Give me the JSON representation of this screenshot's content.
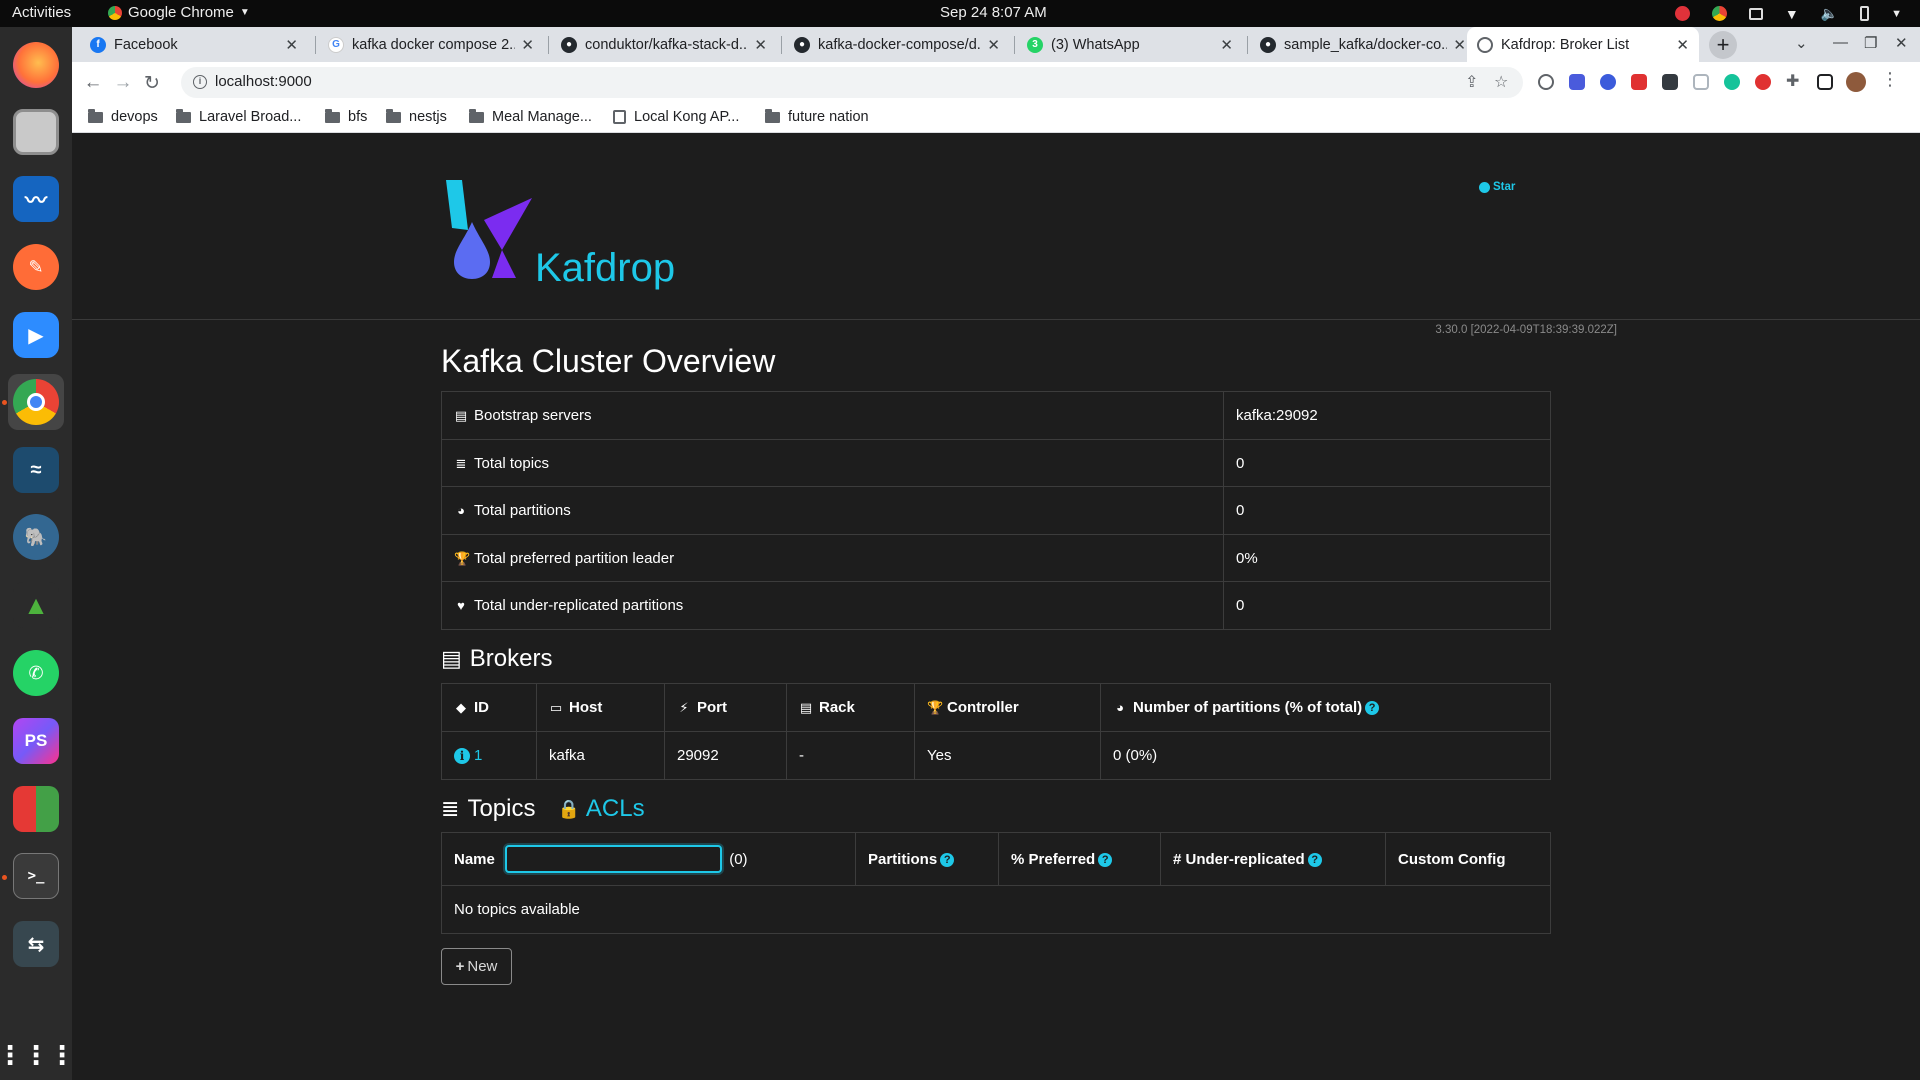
{
  "system": {
    "activities": "Activities",
    "app_name": "Google Chrome",
    "clock": "Sep 24  8:07 AM"
  },
  "tabs": [
    {
      "title": "Facebook",
      "favicon": "facebook-icon",
      "color": "#1877f2"
    },
    {
      "title": "kafka docker compose 2...",
      "favicon": "google-icon",
      "color": "#4285f4"
    },
    {
      "title": "conduktor/kafka-stack-d...",
      "favicon": "github-icon",
      "color": "#24292e"
    },
    {
      "title": "kafka-docker-compose/d...",
      "favicon": "github-icon",
      "color": "#24292e"
    },
    {
      "title": "(3) WhatsApp",
      "favicon": "whatsapp-icon",
      "color": "#25d366"
    },
    {
      "title": "sample_kafka/docker-co...",
      "favicon": "github-icon",
      "color": "#24292e"
    },
    {
      "title": "Kafdrop: Broker List",
      "favicon": "globe-icon",
      "color": "#5f6368",
      "active": true
    }
  ],
  "omnibox": {
    "url": "localhost:9000"
  },
  "bookmarks": [
    {
      "label": "devops",
      "type": "folder"
    },
    {
      "label": "Laravel Broad...",
      "type": "folder"
    },
    {
      "label": "bfs",
      "type": "folder"
    },
    {
      "label": "nestjs",
      "type": "folder"
    },
    {
      "label": "Meal Manage...",
      "type": "folder"
    },
    {
      "label": "Local Kong AP...",
      "type": "page"
    },
    {
      "label": "future nation",
      "type": "folder"
    }
  ],
  "kafdrop": {
    "brand": "Kafdrop",
    "star": "Star",
    "version": "3.30.0 [2022-04-09T18:39:39.022Z]",
    "title": "Kafka Cluster Overview",
    "overview": [
      {
        "label": "Bootstrap servers",
        "value": "kafka:29092",
        "icon": "server-icon"
      },
      {
        "label": "Total topics",
        "value": "0",
        "icon": "database-icon"
      },
      {
        "label": "Total partitions",
        "value": "0",
        "icon": "pie-chart-icon"
      },
      {
        "label": "Total preferred partition leader",
        "value": "0%",
        "icon": "trophy-icon"
      },
      {
        "label": "Total under-replicated partitions",
        "value": "0",
        "icon": "heartbeat-icon"
      }
    ],
    "brokers_heading": "Brokers",
    "brokers_columns": [
      "ID",
      "Host",
      "Port",
      "Rack",
      "Controller",
      "Number of partitions (% of total)"
    ],
    "brokers": [
      {
        "id": "1",
        "host": "kafka",
        "port": "29092",
        "rack": "-",
        "controller": "Yes",
        "partitions": "0 (0%)"
      }
    ],
    "topics_heading": "Topics",
    "acls_label": "ACLs",
    "topics_columns": {
      "name": "Name",
      "count": "(0)",
      "partitions": "Partitions",
      "preferred": "% Preferred",
      "under_replicated": "# Under-replicated",
      "custom_config": "Custom Config"
    },
    "topics_filter_value": "",
    "no_topics": "No topics available",
    "new_button": "New"
  },
  "colors": {
    "accent": "#1ec8e8",
    "background": "#1d1d1d",
    "logo_violet": "#7b2cf0",
    "logo_blue": "#5b6cf2"
  }
}
